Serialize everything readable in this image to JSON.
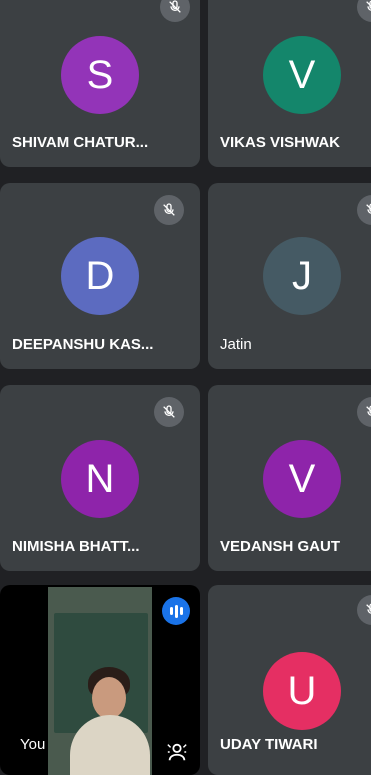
{
  "tiles": [
    {
      "id": "shivam",
      "initial": "S",
      "name": "SHIVAM CHATUR...",
      "avatar_color": "#9334b8"
    },
    {
      "id": "vikas",
      "initial": "V",
      "name": "VIKAS VISHWAK",
      "avatar_color": "#14866b"
    },
    {
      "id": "deepanshu",
      "initial": "D",
      "name": "DEEPANSHU KAS...",
      "avatar_color": "#5c6bc0"
    },
    {
      "id": "jatin",
      "initial": "J",
      "name": "Jatin",
      "avatar_color": "#455a64"
    },
    {
      "id": "nimisha",
      "initial": "N",
      "name": "NIMISHA BHATT...",
      "avatar_color": "#8e24aa"
    },
    {
      "id": "vedansh",
      "initial": "V",
      "name": "VEDANSH GAUT",
      "avatar_color": "#8e24aa"
    },
    {
      "id": "self",
      "name": "You"
    },
    {
      "id": "uday",
      "initial": "U",
      "name": "UDAY TIWARI",
      "avatar_color": "#e52f63"
    }
  ],
  "icons": {
    "muted": "mic-off-icon",
    "speaking": "audio-level-icon",
    "background": "background-blur-icon"
  }
}
